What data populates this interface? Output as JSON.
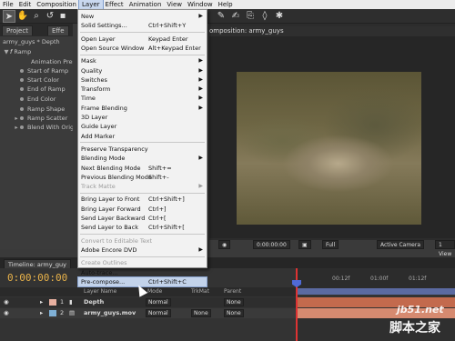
{
  "menubar": {
    "items": [
      "File",
      "Edit",
      "Composition",
      "Layer",
      "Effect",
      "Animation",
      "View",
      "Window",
      "Help"
    ]
  },
  "project_panel": {
    "tabs": [
      "Project",
      "Effe"
    ],
    "header": "army_guys * Depth",
    "effect_name": "Ramp",
    "animation_presets": "Animation Pres",
    "params": [
      "Start of Ramp",
      "Start Color",
      "End of Ramp",
      "End Color",
      "Ramp Shape",
      "Ramp Scatter",
      "Blend With Origi"
    ]
  },
  "composition": {
    "tab_label": "omposition: army_guys",
    "controls": {
      "timecode": "0:00:00:00",
      "resolution": "Full",
      "camera": "Active Camera",
      "view_count": "1 View"
    }
  },
  "timeline": {
    "tab_label": "Timeline: army_guy",
    "timecode": "0:00:00:00",
    "headers": {
      "name": "Layer Name",
      "mode": "Mode",
      "trkmat": "TrkMat",
      "parent": "Parent"
    },
    "ruler_labels": [
      "00:12f",
      "01:00f",
      "01:12f"
    ],
    "layers": [
      {
        "number": "1",
        "name": "Depth",
        "mode": "Normal",
        "trkmat": "",
        "parent": "None",
        "color": "#e8b0a0"
      },
      {
        "number": "2",
        "name": "army_guys.mov",
        "mode": "Normal",
        "trkmat": "None",
        "parent": "None",
        "color": "#7fb0d6"
      }
    ]
  },
  "layer_menu": {
    "items": [
      {
        "label": "New",
        "shortcut": "",
        "submenu": true,
        "disabled": false
      },
      {
        "label": "Solid Settings...",
        "shortcut": "Ctrl+Shift+Y",
        "submenu": false,
        "disabled": false
      },
      {
        "label": "Open Layer",
        "shortcut": "Keypad Enter",
        "submenu": false,
        "disabled": false
      },
      {
        "label": "Open Source Window",
        "shortcut": "Alt+Keypad Enter",
        "submenu": false,
        "disabled": false
      },
      {
        "label": "Mask",
        "shortcut": "",
        "submenu": true,
        "disabled": false
      },
      {
        "label": "Quality",
        "shortcut": "",
        "submenu": true,
        "disabled": false
      },
      {
        "label": "Switches",
        "shortcut": "",
        "submenu": true,
        "disabled": false
      },
      {
        "label": "Transform",
        "shortcut": "",
        "submenu": true,
        "disabled": false
      },
      {
        "label": "Time",
        "shortcut": "",
        "submenu": true,
        "disabled": false
      },
      {
        "label": "Frame Blending",
        "shortcut": "",
        "submenu": true,
        "disabled": false
      },
      {
        "label": "3D Layer",
        "shortcut": "",
        "submenu": false,
        "disabled": false
      },
      {
        "label": "Guide Layer",
        "shortcut": "",
        "submenu": false,
        "disabled": false
      },
      {
        "label": "Add Marker",
        "shortcut": "",
        "submenu": false,
        "disabled": false
      },
      {
        "label": "Preserve Transparency",
        "shortcut": "",
        "submenu": false,
        "disabled": false
      },
      {
        "label": "Blending Mode",
        "shortcut": "",
        "submenu": true,
        "disabled": false
      },
      {
        "label": "Next Blending Mode",
        "shortcut": "Shift+=",
        "submenu": false,
        "disabled": false
      },
      {
        "label": "Previous Blending Mode",
        "shortcut": "Shift+-",
        "submenu": false,
        "disabled": false
      },
      {
        "label": "Track Matte",
        "shortcut": "",
        "submenu": true,
        "disabled": true
      },
      {
        "label": "Bring Layer to Front",
        "shortcut": "Ctrl+Shift+]",
        "submenu": false,
        "disabled": false
      },
      {
        "label": "Bring Layer Forward",
        "shortcut": "Ctrl+]",
        "submenu": false,
        "disabled": false
      },
      {
        "label": "Send Layer Backward",
        "shortcut": "Ctrl+[",
        "submenu": false,
        "disabled": false
      },
      {
        "label": "Send Layer to Back",
        "shortcut": "Ctrl+Shift+[",
        "submenu": false,
        "disabled": false
      },
      {
        "label": "Convert to Editable Text",
        "shortcut": "",
        "submenu": false,
        "disabled": true
      },
      {
        "label": "Adobe Encore DVD",
        "shortcut": "",
        "submenu": true,
        "disabled": false
      },
      {
        "label": "Create Outlines",
        "shortcut": "",
        "submenu": false,
        "disabled": true
      },
      {
        "label": "Auto-trace...",
        "shortcut": "",
        "submenu": false,
        "disabled": false
      },
      {
        "label": "Pre-compose...",
        "shortcut": "Ctrl+Shift+C",
        "submenu": false,
        "disabled": false,
        "highlighted": true
      }
    ]
  },
  "watermark": {
    "site": "jb51.net",
    "cn": "脚本之家"
  }
}
